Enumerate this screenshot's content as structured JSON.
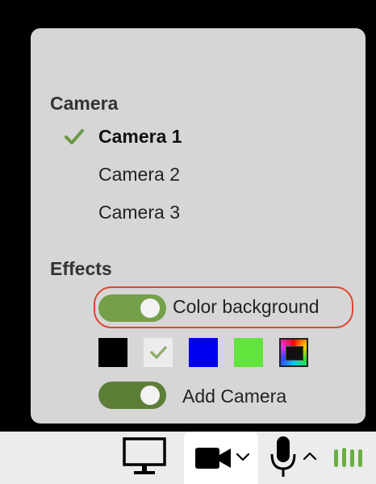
{
  "camera": {
    "title": "Camera",
    "items": [
      {
        "label": "Camera 1",
        "selected": true
      },
      {
        "label": "Camera 2",
        "selected": false
      },
      {
        "label": "Camera 3",
        "selected": false
      }
    ]
  },
  "effects": {
    "title": "Effects",
    "color_background": {
      "label": "Color background",
      "on": true
    },
    "add_camera": {
      "label": "Add Camera",
      "on": true
    },
    "swatches": [
      {
        "name": "black",
        "color": "#000000"
      },
      {
        "name": "white",
        "color": "#ececec",
        "selected": true
      },
      {
        "name": "blue",
        "color": "#0000f0"
      },
      {
        "name": "green",
        "color": "#63e33d"
      },
      {
        "name": "rainbow",
        "color": "multicolor"
      }
    ]
  },
  "colors": {
    "toggle_on": "#73a048",
    "highlight": "#e1452c",
    "check": "#6b9845",
    "panel_bg": "#d6d6d6",
    "toolbar_bg": "#ececec"
  },
  "toolbar": {
    "icons": [
      "monitor-icon",
      "video-camera-icon",
      "chevron-down-icon",
      "microphone-icon",
      "chevron-up-icon",
      "audio-level-icon"
    ]
  }
}
